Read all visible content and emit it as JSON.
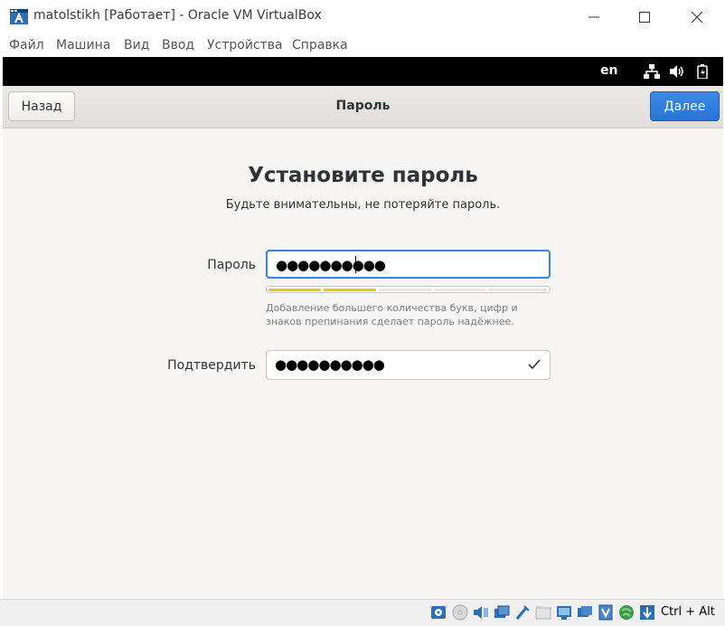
{
  "window": {
    "title": "matolstikh [Работает] - Oracle VM VirtualBox",
    "app_icon": "virtualbox-icon",
    "controls": [
      "minimize-icon",
      "maximize-icon",
      "close-icon"
    ]
  },
  "menubar": {
    "items": [
      {
        "label": "Файл"
      },
      {
        "label": "Машина"
      },
      {
        "label": "Вид"
      },
      {
        "label": "Ввод"
      },
      {
        "label": "Устройства"
      },
      {
        "label": "Справка"
      }
    ]
  },
  "vm": {
    "topbar": {
      "language": "en",
      "icons": [
        "network-icon",
        "volume-icon",
        "battery-icon"
      ]
    },
    "headerbar": {
      "back_label": "Назад",
      "title": "Пароль",
      "next_label": "Далее"
    },
    "page": {
      "heading": "Установите пароль",
      "subtitle": "Будьте внимательны, не потеряйте пароль.",
      "password": {
        "label": "Пароль",
        "value": "●●●●●●●●●●",
        "strength_level": "2/5",
        "hint": "Добавление большего количества букв, цифр и знаков препинания сделает пароль надёжнее."
      },
      "confirm": {
        "label": "Подтвердить",
        "value": "●●●●●●●●●●",
        "status_icon": "check-icon"
      }
    },
    "colors": {
      "accent": "#3584e4",
      "strength_fill": "#f5c211",
      "topbar": "#000000",
      "background": "#f6f5f4"
    }
  },
  "statusbar": {
    "icons": [
      "hard-disk-icon",
      "optical-drive-icon",
      "audio-icon",
      "network-adapter-icon",
      "usb-icon",
      "shared-folders-icon",
      "display-icon",
      "video-capture-icon",
      "cpu-icon",
      "mouse-integration-icon",
      "keyboard-capture-icon"
    ],
    "host_key": "Ctrl + Alt"
  }
}
